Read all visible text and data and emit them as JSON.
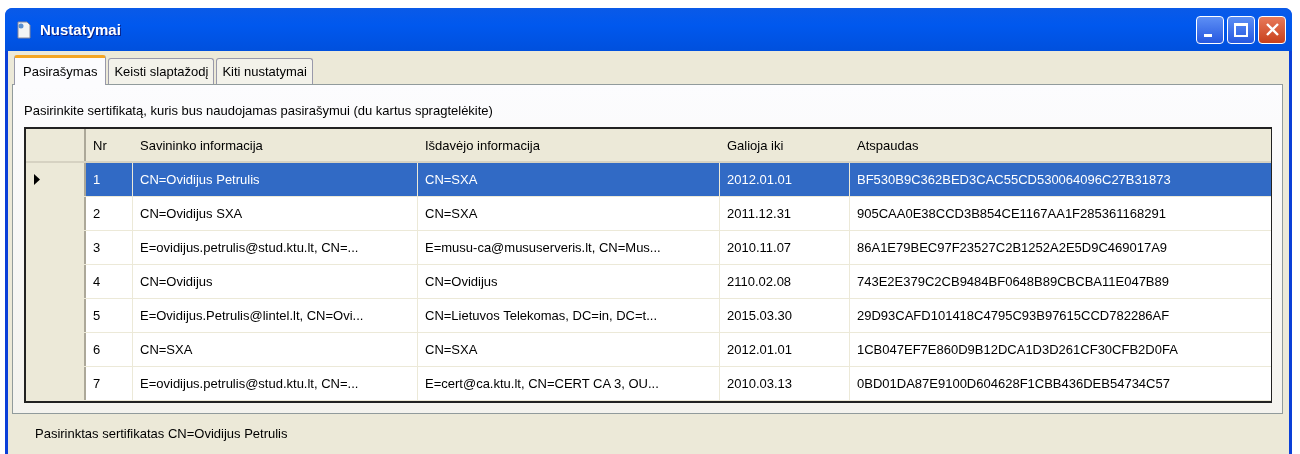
{
  "window": {
    "title": "Nustatymai"
  },
  "tabs": [
    {
      "label": "Pasirašymas",
      "selected": true
    },
    {
      "label": "Keisti slaptažodį",
      "selected": false
    },
    {
      "label": "Kiti nustatymai",
      "selected": false
    }
  ],
  "instruction": "Pasirinkite sertifikatą, kuris bus naudojamas pasirašymui (du kartus spragtelėkite)",
  "table": {
    "columns": [
      "Nr",
      "Savininko informacija",
      "Išdavėjo informacija",
      "Galioja iki",
      "Atspaudas"
    ],
    "rows": [
      {
        "cells": [
          "1",
          "CN=Ovidijus Petrulis",
          "CN=SXA",
          "2012.01.01",
          "BF530B9C362BED3CAC55CD530064096C27B31873"
        ],
        "selected": true
      },
      {
        "cells": [
          "2",
          "CN=Ovidijus SXA",
          "CN=SXA",
          "2011.12.31",
          "905CAA0E38CCD3B854CE1167AA1F285361168291"
        ],
        "selected": false
      },
      {
        "cells": [
          "3",
          "E=ovidijus.petrulis@stud.ktu.lt, CN=...",
          "E=musu-ca@mususerveris.lt, CN=Mus...",
          "2010.11.07",
          "86A1E79BEC97F23527C2B1252A2E5D9C469017A9"
        ],
        "selected": false
      },
      {
        "cells": [
          "4",
          "CN=Ovidijus",
          "CN=Ovidijus",
          "2110.02.08",
          "743E2E379C2CB9484BF0648B89CBCBA11E047B89"
        ],
        "selected": false
      },
      {
        "cells": [
          "5",
          "E=Ovidijus.Petrulis@lintel.lt, CN=Ovi...",
          "CN=Lietuvos Telekomas, DC=in, DC=t...",
          "2015.03.30",
          "29D93CAFD101418C4795C93B97615CCD782286AF"
        ],
        "selected": false
      },
      {
        "cells": [
          "6",
          "CN=SXA",
          "CN=SXA",
          "2012.01.01",
          "1CB047EF7E860D9B12DCA1D3D261CF30CFB2D0FA"
        ],
        "selected": false
      },
      {
        "cells": [
          "7",
          "E=ovidijus.petrulis@stud.ktu.lt, CN=...",
          "E=cert@ca.ktu.lt, CN=CERT CA 3, OU...",
          "2010.03.13",
          "0BD01DA87E9100D604628F1CBB436DEB54734C57"
        ],
        "selected": false
      }
    ]
  },
  "status": "Pasirinktas sertifikatas CN=Ovidijus Petrulis"
}
